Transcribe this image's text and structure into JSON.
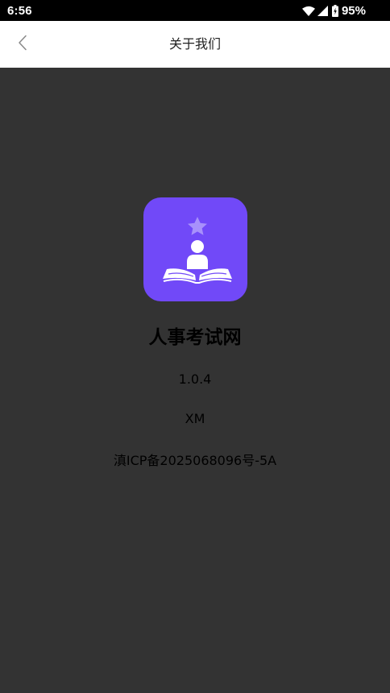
{
  "status_bar": {
    "time": "6:56",
    "battery_percent": "95%",
    "icons": [
      "wifi-icon",
      "cell-signal-icon",
      "battery-icon"
    ]
  },
  "header": {
    "title": "关于我们",
    "back_icon": "chevron-left-icon"
  },
  "about": {
    "app_name": "人事考试网",
    "version": "1.0.4",
    "company": "XM",
    "icp": "滇ICP备2025068096号-5A"
  },
  "colors": {
    "accent": "#7149f8",
    "icon_star": "#a891fb",
    "content_background": "#333333",
    "header_background": "#ffffff",
    "status_background": "#000000"
  }
}
